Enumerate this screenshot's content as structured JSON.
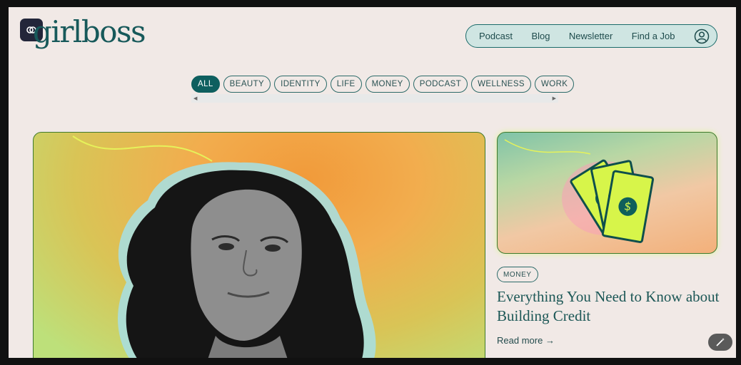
{
  "brand": {
    "logo": "girlboss"
  },
  "nav": {
    "items": [
      "Podcast",
      "Blog",
      "Newsletter",
      "Find a Job"
    ],
    "account_icon": "user-circle-icon"
  },
  "categories": {
    "items": [
      "ALL",
      "BEAUTY",
      "IDENTITY",
      "LIFE",
      "MONEY",
      "PODCAST",
      "WELLNESS",
      "WORK"
    ],
    "active": "ALL"
  },
  "feature_card": {
    "tag": "MONEY",
    "title": "Everything You Need to Know about Building Credit",
    "read_more": "Read more",
    "arrow": "→",
    "image_icon": "money-bills-icon"
  },
  "hero": {
    "image_icon": "portrait-photo"
  },
  "colors": {
    "accent": "#0e5f5f",
    "nav_bg": "#cfe5e2",
    "page_bg": "#f1e9e6"
  }
}
